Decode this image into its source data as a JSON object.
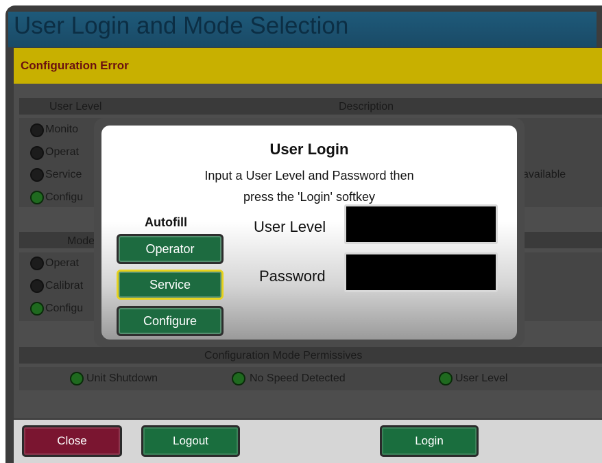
{
  "window": {
    "title": "User Login and Mode Selection",
    "error": "Configuration Error"
  },
  "background": {
    "user_level_header": "User Level",
    "description_header": "Description",
    "user_levels": [
      "Monito",
      "Operat",
      "Service",
      "Configu"
    ],
    "description_partial": "available",
    "mode_header": "Mode",
    "modes": [
      "Operat",
      "Calibrat",
      "Configu"
    ],
    "permissives_header": "Configuration Mode Permissives",
    "permissives": [
      "Unit Shutdown",
      "No Speed Detected",
      "User Level"
    ]
  },
  "footer": {
    "close": "Close",
    "logout": "Logout",
    "login": "Login"
  },
  "modal": {
    "title": "User Login",
    "line1": "Input a User Level and Password then",
    "line2": "press the 'Login' softkey",
    "autofill_label": "Autofill",
    "autofill_buttons": [
      "Operator",
      "Service",
      "Configure"
    ],
    "user_level_label": "User Level",
    "password_label": "Password",
    "user_level_value": "",
    "password_value": ""
  },
  "colors": {
    "accent_green": "#1d6b40",
    "focus_yellow": "#e6d21e",
    "close_red": "#7a1530",
    "error_bar": "#c8b000"
  }
}
